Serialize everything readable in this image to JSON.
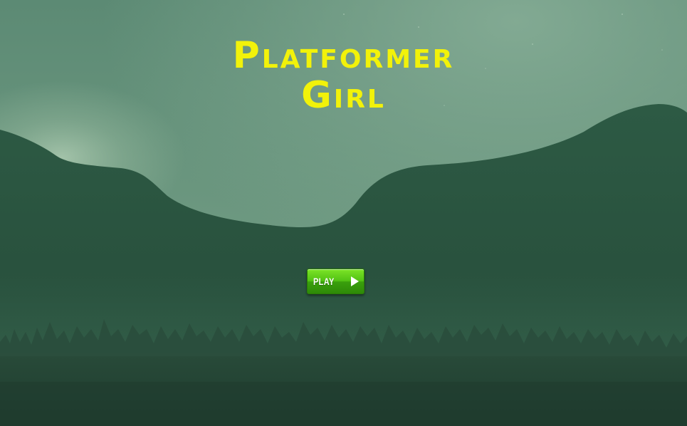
{
  "game": {
    "title_line1": "Platformer",
    "title_line2": "Girl"
  },
  "menu": {
    "play_label": "PLAY",
    "play_icon": "play-triangle-icon"
  },
  "colors": {
    "title": "#f2f20a",
    "sky": "#6e9a82",
    "hills": "#2b5340",
    "button": "#52c214"
  }
}
